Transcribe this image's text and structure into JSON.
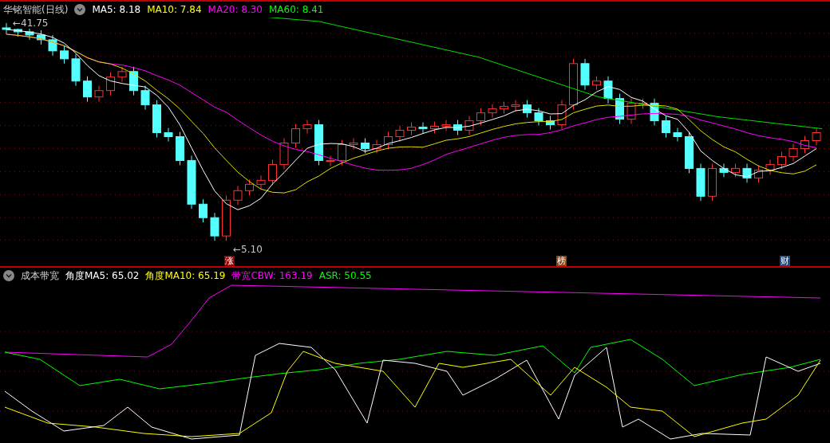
{
  "main_panel": {
    "title": "华铭智能(日线)",
    "indicators": [
      {
        "label": "MA5: 8.18",
        "color": "#ffffff"
      },
      {
        "label": "MA10: 7.84",
        "color": "#ffff00"
      },
      {
        "label": "MA20: 8.30",
        "color": "#ff00ff"
      },
      {
        "label": "MA60: 8.41",
        "color": "#00ff00"
      }
    ],
    "price_labels": [
      "←41.75",
      "←5.10"
    ],
    "event_tags": [
      {
        "label": "涨",
        "color": "#8b0000"
      },
      {
        "label": "榜",
        "color": "#8b4513"
      },
      {
        "label": "财",
        "color": "#1e4b8c"
      }
    ]
  },
  "sub_panel": {
    "title": "成本带宽",
    "indicators": [
      {
        "label": "角度MA5: 65.02",
        "color": "#ffffff"
      },
      {
        "label": "角度MA10: 65.19",
        "color": "#ffff00"
      },
      {
        "label": "带宽CBW: 163.19",
        "color": "#ff00ff"
      },
      {
        "label": "ASR: 50.55",
        "color": "#00ff00"
      }
    ]
  }
}
